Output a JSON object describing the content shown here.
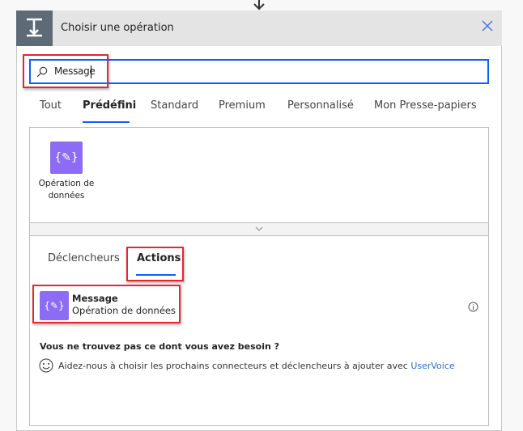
{
  "header": {
    "title": "Choisir une opération",
    "icon": "operation-icon",
    "close_icon": "close-icon"
  },
  "search": {
    "value": "Message",
    "icon": "search-icon"
  },
  "tabs": [
    {
      "label": "Tout"
    },
    {
      "label": "Prédéfini",
      "selected": true
    },
    {
      "label": "Standard"
    },
    {
      "label": "Premium"
    },
    {
      "label": "Personnalisé"
    },
    {
      "label": "Mon Presse-papiers"
    }
  ],
  "connectors": [
    {
      "label_line1": "Opération de",
      "label_line2": "données",
      "icon": "data-operation-icon",
      "color": "#8c6cf5"
    }
  ],
  "subtabs": [
    {
      "label": "Déclencheurs"
    },
    {
      "label": "Actions",
      "selected": true
    }
  ],
  "results": [
    {
      "title": "Message",
      "subtitle": "Opération de données",
      "icon": "data-operation-icon"
    }
  ],
  "help": {
    "heading": "Vous ne trouvez pas ce dont vous avez besoin ?",
    "text": "Aidez-nous à choisir les prochains connecteurs et déclencheurs à ajouter avec",
    "link": "UserVoice"
  },
  "colors": {
    "accent": "#0a5fff",
    "highlight": "#e8262d",
    "connector": "#8c6cf5"
  }
}
